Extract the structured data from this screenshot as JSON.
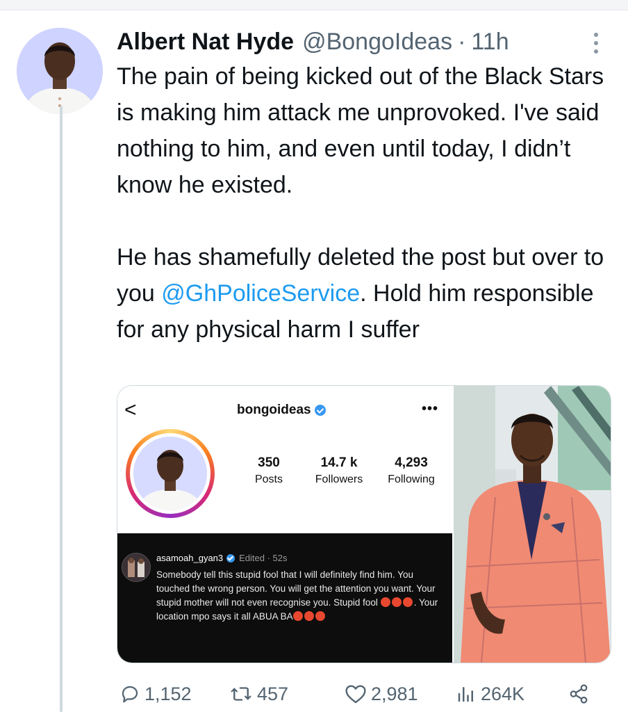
{
  "tweet": {
    "author_name": "Albert Nat Hyde",
    "handle": "@BongoIdeas",
    "separator": "·",
    "time": "11h",
    "text_p1": "The pain of being kicked out of the Black Stars is making him attack me unprovoked. I've said nothing to him, and even until today, I didn’t know he existed.",
    "text_p2_before": "He has shamefully deleted the post but over to you ",
    "mention": "@GhPoliceService",
    "text_p2_after": ". Hold him responsible for any physical harm I suffer"
  },
  "embedded_screenshot": {
    "back_glyph": "<",
    "username": "bongoideas",
    "more_glyph": "•••",
    "posts_value": "350",
    "posts_label": "Posts",
    "followers_value": "14.7 k",
    "followers_label": "Followers",
    "following_value": "4,293",
    "following_label": "Following",
    "comment_user": "asamoah_gyan3",
    "comment_meta": "Edited · 52s",
    "comment_text_1": "Somebody tell this stupid fool that I will definitely find him. You touched the wrong person. You will get the attention you want. Your stupid mother will not even recognise you. Stupid fool ",
    "comment_text_2": ". Your location mpo says it all ABUA BA"
  },
  "actions": {
    "replies": "1,152",
    "retweets": "457",
    "likes": "2,981",
    "views": "264K"
  },
  "colors": {
    "accent": "#1d9bf0",
    "muted": "#536471",
    "ig_verified": "#3897f0",
    "angry_emoji": "#e8482f"
  },
  "icons": [
    "reply-icon",
    "retweet-icon",
    "like-icon",
    "views-icon",
    "share-icon",
    "more-icon",
    "verified-icon"
  ]
}
